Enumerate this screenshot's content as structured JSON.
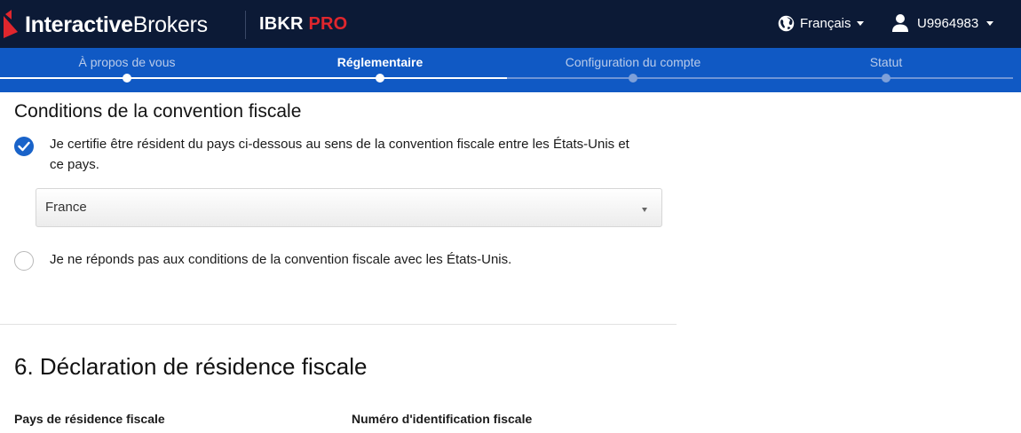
{
  "header": {
    "logo_bold": "Interactive",
    "logo_regular": "Brokers",
    "product_name": "IBKR",
    "product_tier": "PRO",
    "language_label": "Français",
    "user_id": "U9964983",
    "icons": {
      "language": "globe-icon",
      "user": "user-icon",
      "dropdown": "caret-down-icon"
    },
    "colors": {
      "background": "#0c1a36",
      "accent_red": "#e0262d"
    }
  },
  "stepper": {
    "steps": [
      {
        "label": "À propos de vous",
        "state": "done"
      },
      {
        "label": "Réglementaire",
        "state": "active"
      },
      {
        "label": "Configuration du compte",
        "state": "todo"
      },
      {
        "label": "Statut",
        "state": "todo"
      }
    ],
    "colors": {
      "background": "#1059c4",
      "done": "#ffffff",
      "todo": "#7ea0d9"
    }
  },
  "treaty": {
    "title": "Conditions de la convention fiscale",
    "option_certify": {
      "line1": "Je certifie être résident du pays ci-dessous au sens de la convention fiscale entre les États-Unis et",
      "line2": "ce pays.",
      "checked": true
    },
    "country_select": {
      "value": "France"
    },
    "option_decline": {
      "text": "Je ne réponds pas aux conditions de la convention fiscale avec les États-Unis.",
      "checked": false
    },
    "colors": {
      "radio_checked": "#1963c9"
    }
  },
  "residence": {
    "title": "6. Déclaration de résidence fiscale",
    "country_label": "Pays de résidence fiscale",
    "tin_label": "Numéro d'identification fiscale"
  }
}
